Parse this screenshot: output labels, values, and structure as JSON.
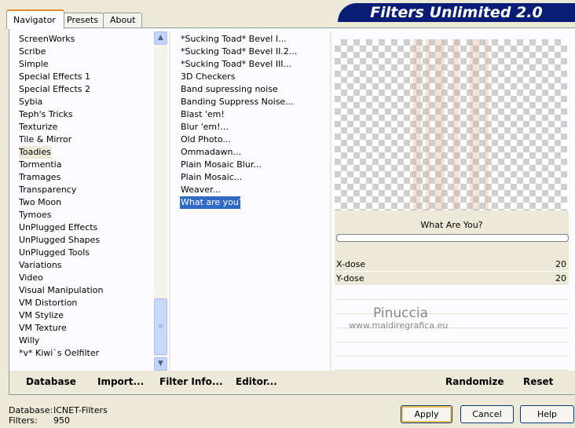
{
  "tabs": [
    "Navigator",
    "Presets",
    "About"
  ],
  "banner_title": "Filters Unlimited 2.0",
  "categories": [
    "ScreenWorks",
    "Scribe",
    "Simple",
    "Special Effects 1",
    "Special Effects 2",
    "Sybia",
    "Teph's Tricks",
    "Texturize",
    "Tile & Mirror",
    "Toadies",
    "Tormentia",
    "Tramages",
    "Transparency",
    "Two Moon",
    "Tymoes",
    "UnPlugged Effects",
    "UnPlugged Shapes",
    "UnPlugged Tools",
    "Variations",
    "Video",
    "Visual Manipulation",
    "VM Distortion",
    "VM Stylize",
    "VM Texture",
    "Willy",
    "*v* Kiwi`s Oelfilter"
  ],
  "selected_category": "Toadies",
  "filters": [
    "*Sucking Toad*  Bevel I...",
    "*Sucking Toad*  Bevel II.2...",
    "*Sucking Toad*  Bevel III...",
    "3D Checkers",
    "Band supressing noise",
    "Banding Suppress Noise...",
    "Blast 'em!",
    "Blur 'em!...",
    "Old Photo...",
    "Ommadawn...",
    "Plain Mosaic Blur...",
    "Plain Mosaic...",
    "Weaver...",
    "What are you?"
  ],
  "selected_filter": "What are you?",
  "bottom_buttons": {
    "database": "Database",
    "import": "Import...",
    "filter_info": "Filter Info...",
    "editor": "Editor...",
    "randomize": "Randomize",
    "reset": "Reset"
  },
  "filter_title": "What Are You?",
  "params": [
    {
      "name": "X-dose",
      "value": "20"
    },
    {
      "name": "Y-dose",
      "value": "20"
    }
  ],
  "watermark": {
    "line1": "Pinuccia",
    "line2": "www.maidiregrafica.eu"
  },
  "status": {
    "database_label": "Database:",
    "database_value": "ICNET-Filters",
    "filters_label": "Filters:",
    "filters_value": "950"
  },
  "dialog_buttons": {
    "apply": "Apply",
    "cancel": "Cancel",
    "help": "Help"
  },
  "icons": {
    "scroll_up": "chevron-up-icon",
    "scroll_down": "chevron-down-icon",
    "scroll_grip": "grip-icon"
  }
}
